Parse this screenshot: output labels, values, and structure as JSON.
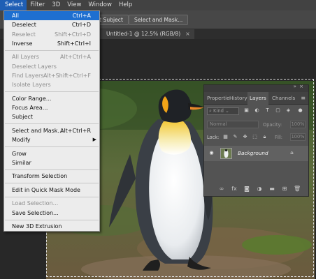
{
  "menubar": {
    "items": [
      "Select",
      "Filter",
      "3D",
      "View",
      "Window",
      "Help"
    ],
    "active": "Select"
  },
  "options_bar": {
    "buttons": [
      "ct Subject",
      "Select and Mask..."
    ]
  },
  "document_tab": {
    "title": "Untitled-1 @ 12.5% (RGB/8)",
    "close": "×"
  },
  "select_menu": {
    "items": [
      {
        "label": "All",
        "shortcut": "Ctrl+A",
        "state": "highlighted"
      },
      {
        "label": "Deselect",
        "shortcut": "Ctrl+D",
        "state": "enabled"
      },
      {
        "label": "Reselect",
        "shortcut": "Shift+Ctrl+D",
        "state": "disabled"
      },
      {
        "label": "Inverse",
        "shortcut": "Shift+Ctrl+I",
        "state": "enabled"
      },
      {
        "sep": true
      },
      {
        "label": "All Layers",
        "shortcut": "Alt+Ctrl+A",
        "state": "disabled"
      },
      {
        "label": "Deselect Layers",
        "shortcut": "",
        "state": "disabled"
      },
      {
        "label": "Find Layers",
        "shortcut": "Alt+Shift+Ctrl+F",
        "state": "disabled"
      },
      {
        "label": "Isolate Layers",
        "shortcut": "",
        "state": "disabled"
      },
      {
        "sep": true
      },
      {
        "label": "Color Range...",
        "shortcut": "",
        "state": "enabled"
      },
      {
        "label": "Focus Area...",
        "shortcut": "",
        "state": "enabled"
      },
      {
        "label": "Subject",
        "shortcut": "",
        "state": "enabled"
      },
      {
        "sep": true
      },
      {
        "label": "Select and Mask...",
        "shortcut": "Alt+Ctrl+R",
        "state": "enabled"
      },
      {
        "label": "Modify",
        "shortcut": "",
        "state": "enabled",
        "submenu": true
      },
      {
        "sep": true
      },
      {
        "label": "Grow",
        "shortcut": "",
        "state": "enabled"
      },
      {
        "label": "Similar",
        "shortcut": "",
        "state": "enabled"
      },
      {
        "sep": true
      },
      {
        "label": "Transform Selection",
        "shortcut": "",
        "state": "enabled"
      },
      {
        "sep": true
      },
      {
        "label": "Edit in Quick Mask Mode",
        "shortcut": "",
        "state": "enabled"
      },
      {
        "sep": true
      },
      {
        "label": "Load Selection...",
        "shortcut": "",
        "state": "disabled"
      },
      {
        "label": "Save Selection...",
        "shortcut": "",
        "state": "enabled"
      },
      {
        "sep": true
      },
      {
        "label": "New 3D Extrusion",
        "shortcut": "",
        "state": "enabled"
      }
    ],
    "submenu_arrow": "▶"
  },
  "layers_panel": {
    "tabs": [
      "Propertie",
      "History",
      "Layers",
      "Channels"
    ],
    "active_tab": "Layers",
    "kind_filter": "Kind",
    "blend_mode": "Normal",
    "opacity_label": "Opacity:",
    "opacity_value": "100%",
    "lock_label": "Lock:",
    "fill_label": "Fill:",
    "fill_value": "100%",
    "layer_name": "Background"
  },
  "colors": {
    "menubar_bg": "#424242",
    "menu_highlight": "#1e6fd0",
    "panel_bg": "#535353",
    "workspace_bg": "#282828"
  }
}
